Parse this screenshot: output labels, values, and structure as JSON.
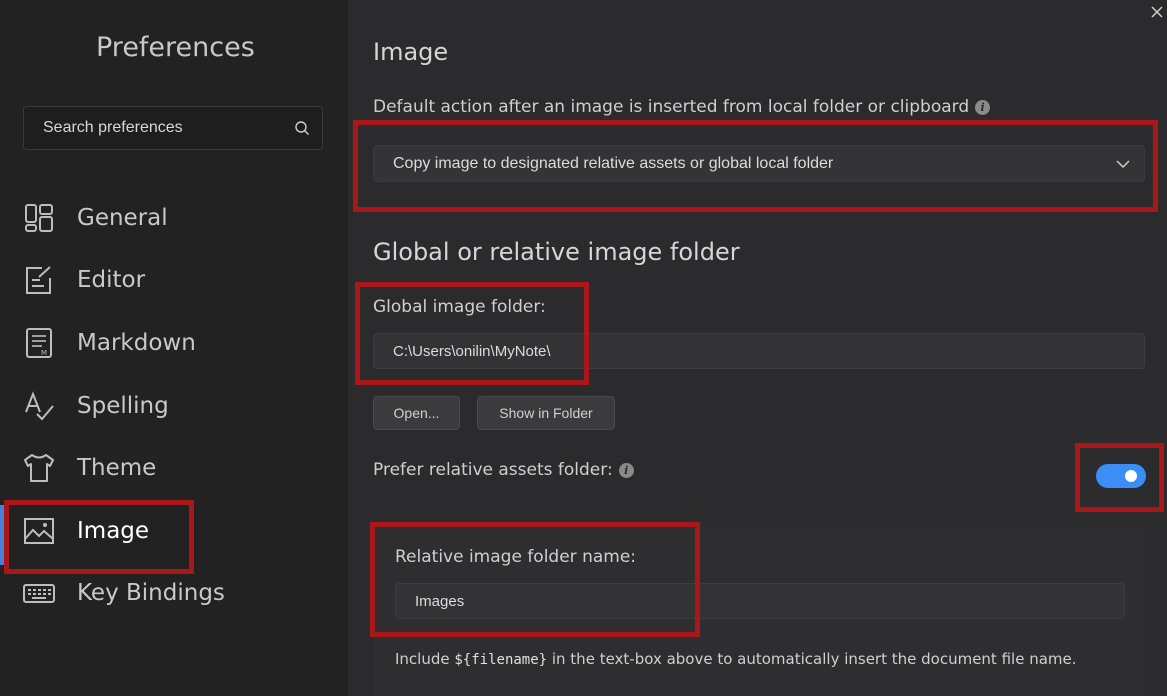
{
  "sidebar": {
    "title": "Preferences",
    "search": {
      "placeholder": "Search preferences"
    },
    "items": [
      {
        "label": "General",
        "icon": "general-icon"
      },
      {
        "label": "Editor",
        "icon": "editor-icon"
      },
      {
        "label": "Markdown",
        "icon": "markdown-icon"
      },
      {
        "label": "Spelling",
        "icon": "spelling-icon"
      },
      {
        "label": "Theme",
        "icon": "theme-icon"
      },
      {
        "label": "Image",
        "icon": "image-icon",
        "active": true
      },
      {
        "label": "Key Bindings",
        "icon": "keyboard-icon"
      }
    ]
  },
  "main": {
    "title": "Image",
    "default_action": {
      "label": "Default action after an image is inserted from local folder or clipboard",
      "selected": "Copy image to designated relative assets or global local folder"
    },
    "folder_section": {
      "title": "Global or relative image folder",
      "global_label": "Global image folder:",
      "global_value": "C:\\Users\\onilin\\MyNote\\",
      "open_button": "Open...",
      "show_button": "Show in Folder",
      "prefer_label": "Prefer relative assets folder:",
      "prefer_enabled": true,
      "relative_label": "Relative image folder name:",
      "relative_value": "Images",
      "help_prefix": "Include ",
      "help_code": "${filename}",
      "help_suffix": " in the text-box above to automatically insert the document file name."
    }
  },
  "colors": {
    "accent": "#3a8ef6",
    "highlight": "#a8181b",
    "active_indicator": "#4e7fd6"
  }
}
